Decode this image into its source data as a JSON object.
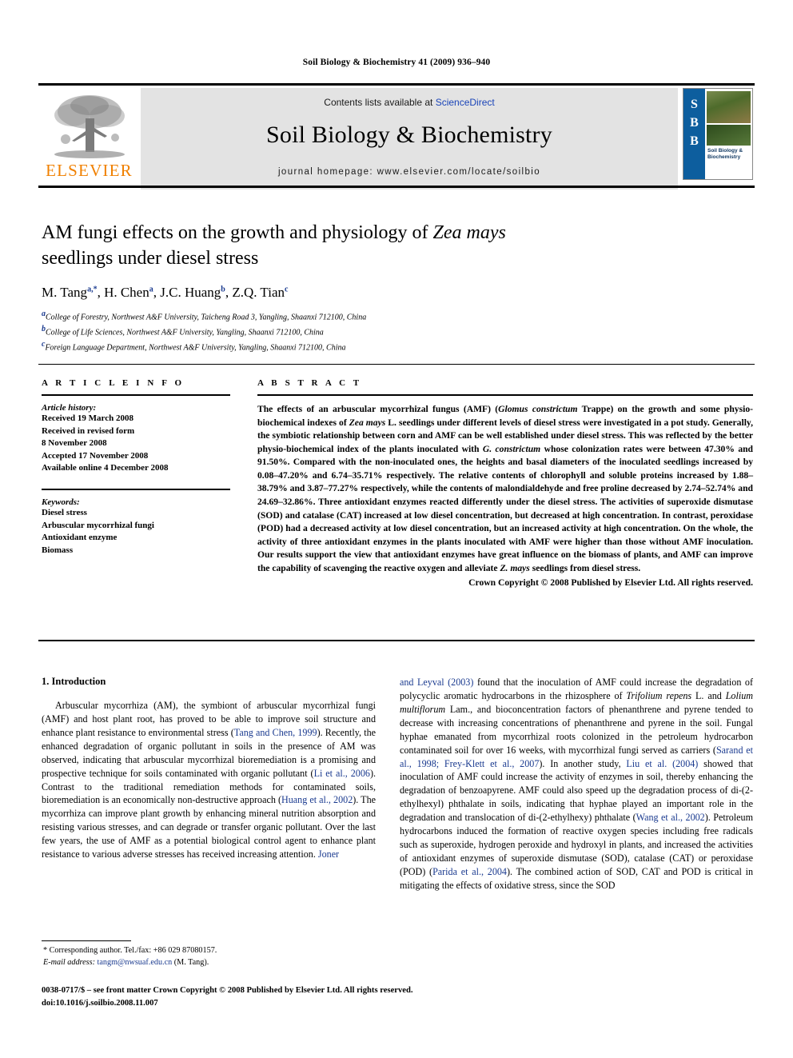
{
  "running_head": "Soil Biology & Biochemistry 41 (2009) 936–940",
  "masthead": {
    "publisher_name": "ELSEVIER",
    "contents_prefix": "Contents lists available at ",
    "contents_link": "ScienceDirect",
    "journal_title": "Soil Biology & Biochemistry",
    "homepage": "journal homepage: www.elsevier.com/locate/soilbio",
    "cover": {
      "letters": [
        "S",
        "B",
        "B"
      ],
      "caption": "Soil Biology & Biochemistry"
    }
  },
  "article": {
    "title_line1_pre": "AM fungi effects on the growth and physiology of ",
    "title_line1_italic": "Zea mays",
    "title_line2": "seedlings under diesel stress",
    "authors": [
      {
        "name": "M. Tang",
        "sup": "a,*"
      },
      {
        "name": "H. Chen",
        "sup": "a"
      },
      {
        "name": "J.C. Huang",
        "sup": "b"
      },
      {
        "name": "Z.Q. Tian",
        "sup": "c"
      }
    ],
    "affiliations": [
      {
        "marker": "a",
        "text": "College of Forestry, Northwest A&F University, Taicheng Road 3, Yangling, Shaanxi 712100, China"
      },
      {
        "marker": "b",
        "text": "College of Life Sciences, Northwest A&F University, Yangling, Shaanxi 712100, China"
      },
      {
        "marker": "c",
        "text": "Foreign Language Department, Northwest A&F University, Yangling, Shaanxi 712100, China"
      }
    ]
  },
  "article_info": {
    "heading": "A R T I C L E  I N F O",
    "history_label": "Article history:",
    "history": [
      "Received 19 March 2008",
      "Received in revised form",
      "8 November 2008",
      "Accepted 17 November 2008",
      "Available online 4 December 2008"
    ],
    "keywords_label": "Keywords:",
    "keywords": [
      "Diesel stress",
      "Arbuscular mycorrhizal fungi",
      "Antioxidant enzyme",
      "Biomass"
    ]
  },
  "abstract": {
    "heading": "A B S T R A C T",
    "p1_a": "The effects of an arbuscular mycorrhizal fungus (AMF) (",
    "p1_i1": "Glomus constrictum",
    "p1_b": " Trappe) on the growth and some physio-biochemical indexes of ",
    "p1_i2": "Zea mays",
    "p1_c": " L. seedlings under different levels of diesel stress were investigated in a pot study. Generally, the symbiotic relationship between corn and AMF can be well established under diesel stress. This was reflected by the better physio-biochemical index of the plants inoculated with ",
    "p1_i3": "G. constrictum",
    "p1_d": " whose colonization rates were between 47.30% and 91.50%. Compared with the non-inoculated ones, the heights and basal diameters of the inoculated seedlings increased by 0.08–47.20% and 6.74–35.71% respectively. The relative contents of chlorophyll and soluble proteins increased by 1.88–38.79% and 3.87–77.27% respectively, while the contents of malondialdehyde and free proline decreased by 2.74–52.74% and 24.69–32.86%. Three antioxidant enzymes reacted differently under the diesel stress. The activities of superoxide dismutase (SOD) and catalase (CAT) increased at low diesel concentration, but decreased at high concentration. In contrast, peroxidase (POD) had a decreased activity at low diesel concentration, but an increased activity at high concentration. On the whole, the activity of three antioxidant enzymes in the plants inoculated with AMF were higher than those without AMF inoculation. Our results support the view that antioxidant enzymes have great influence on the biomass of plants, and AMF can improve the capability of scavenging the reactive oxygen and alleviate ",
    "p1_i4": "Z. mays",
    "p1_e": " seedlings from diesel stress.",
    "copyright": "Crown Copyright © 2008 Published by Elsevier Ltd. All rights reserved."
  },
  "introduction": {
    "heading": "1. Introduction",
    "left_a": "Arbuscular mycorrhiza (AM), the symbiont of arbuscular mycorrhizal fungi (AMF) and host plant root, has proved to be able to improve soil structure and enhance plant resistance to environmental stress (",
    "left_r1": "Tang and Chen, 1999",
    "left_b": "). Recently, the enhanced degradation of organic pollutant in soils in the presence of AM was observed, indicating that arbuscular mycorrhizal bioremediation is a promising and prospective technique for soils contaminated with organic pollutant (",
    "left_r2": "Li et al., 2006",
    "left_c": "). Contrast to the traditional remediation methods for contaminated soils, bioremediation is an economically non-destructive approach (",
    "left_r3": "Huang et al., 2002",
    "left_d": "). The mycorrhiza can improve plant growth by enhancing mineral nutrition absorption and resisting various stresses, and can degrade or transfer organic pollutant. Over the last few years, the use of AMF as a potential biological control agent to enhance plant resistance to various adverse stresses has received increasing attention. ",
    "left_r4": "Joner",
    "right_r1": "and Leyval (2003)",
    "right_a": " found that the inoculation of AMF could increase the degradation of polycyclic aromatic hydrocarbons in the rhizosphere of ",
    "right_i1": "Trifolium repens",
    "right_b": " L. and ",
    "right_i2": "Lolium multiflorum",
    "right_c": " Lam., and bioconcentration factors of phenanthrene and pyrene tended to decrease with increasing concentrations of phenanthrene and pyrene in the soil. Fungal hyphae emanated from mycorrhizal roots colonized in the petroleum hydrocarbon contaminated soil for over 16 weeks, with mycorrhizal fungi served as carriers (",
    "right_r2": "Sarand et al., 1998; Frey-Klett et al., 2007",
    "right_d": "). In another study, ",
    "right_r3": "Liu et al. (2004)",
    "right_e": " showed that inoculation of AMF could increase the activity of enzymes in soil, thereby enhancing the degradation of benzoapyrene. AMF could also speed up the degradation process of di-(2-ethylhexyl) phthalate in soils, indicating that hyphae played an important role in the degradation and translocation of di-(2-ethylhexy) phthalate (",
    "right_r4": "Wang et al., 2002",
    "right_f": "). Petroleum hydrocarbons induced the formation of reactive oxygen species including free radicals such as superoxide, hydrogen peroxide and hydroxyl in plants, and increased the activities of antioxidant enzymes of superoxide dismutase (SOD), catalase (CAT) or peroxidase (POD) (",
    "right_r5": "Parida et al., 2004",
    "right_g": "). The combined action of SOD, CAT and POD is critical in mitigating the effects of oxidative stress, since the SOD"
  },
  "footnote": {
    "corresponding": "* Corresponding author. Tel./fax: +86 029 87080157.",
    "email_label": "E-mail address:",
    "email": "tangm@nwsuaf.edu.cn",
    "email_suffix": " (M. Tang)."
  },
  "footer": {
    "line1": "0038-0717/$ – see front matter Crown Copyright © 2008 Published by Elsevier Ltd. All rights reserved.",
    "line2": "doi:10.1016/j.soilbio.2008.11.007"
  }
}
